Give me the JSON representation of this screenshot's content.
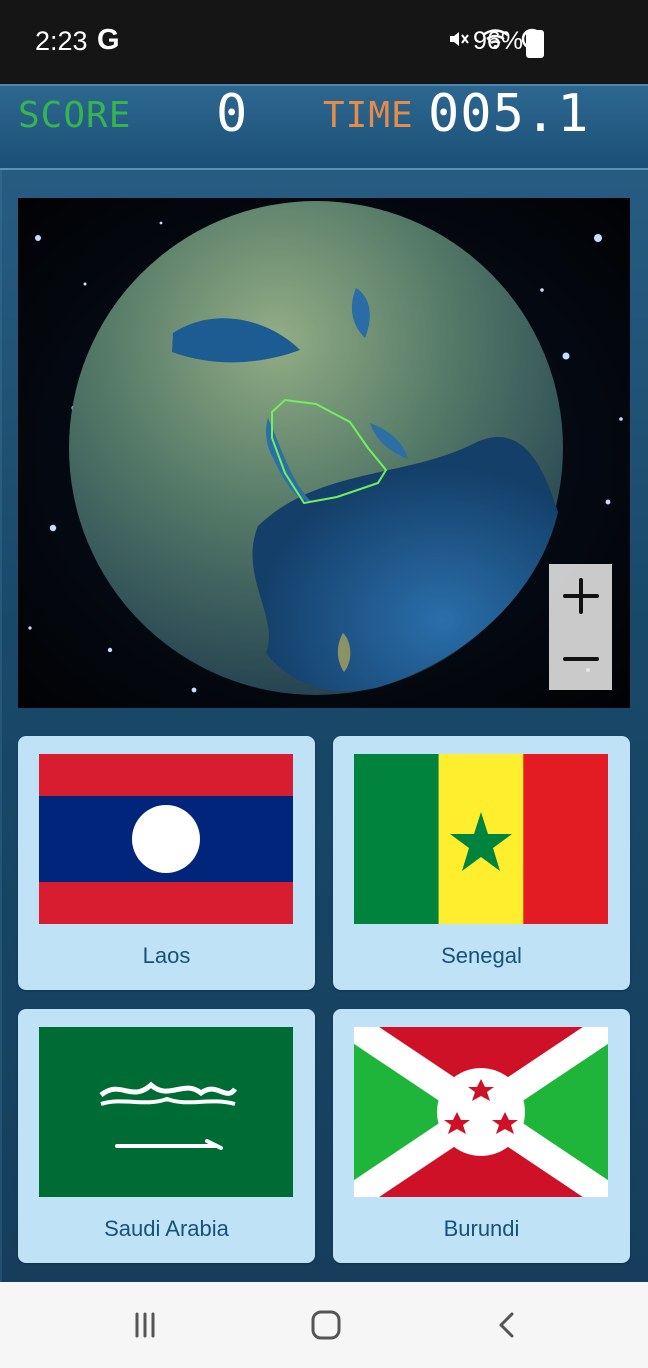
{
  "status_bar": {
    "time": "2:23",
    "app_icon": "G",
    "battery": "96%",
    "icons": [
      "mute-icon",
      "wifi-icon",
      "do-not-disturb-icon",
      "battery-icon"
    ]
  },
  "hud": {
    "score_label": "SCORE",
    "score_value": "0",
    "time_label": "TIME",
    "time_value": "005.1"
  },
  "globe": {
    "highlighted_region": "highlighted-country-outline",
    "zoom_in_icon": "plus-icon",
    "zoom_out_icon": "minus-icon"
  },
  "answers": [
    {
      "label": "Laos",
      "flag": "laos-flag"
    },
    {
      "label": "Senegal",
      "flag": "senegal-flag"
    },
    {
      "label": "Saudi Arabia",
      "flag": "saudi-arabia-flag"
    },
    {
      "label": "Burundi",
      "flag": "burundi-flag"
    }
  ],
  "colors": {
    "score": "#35b54d",
    "time": "#e48c4a",
    "card": "#bfe2f6"
  },
  "nav": {
    "recent_icon": "recent-apps-icon",
    "home_icon": "home-icon",
    "back_icon": "back-icon"
  }
}
